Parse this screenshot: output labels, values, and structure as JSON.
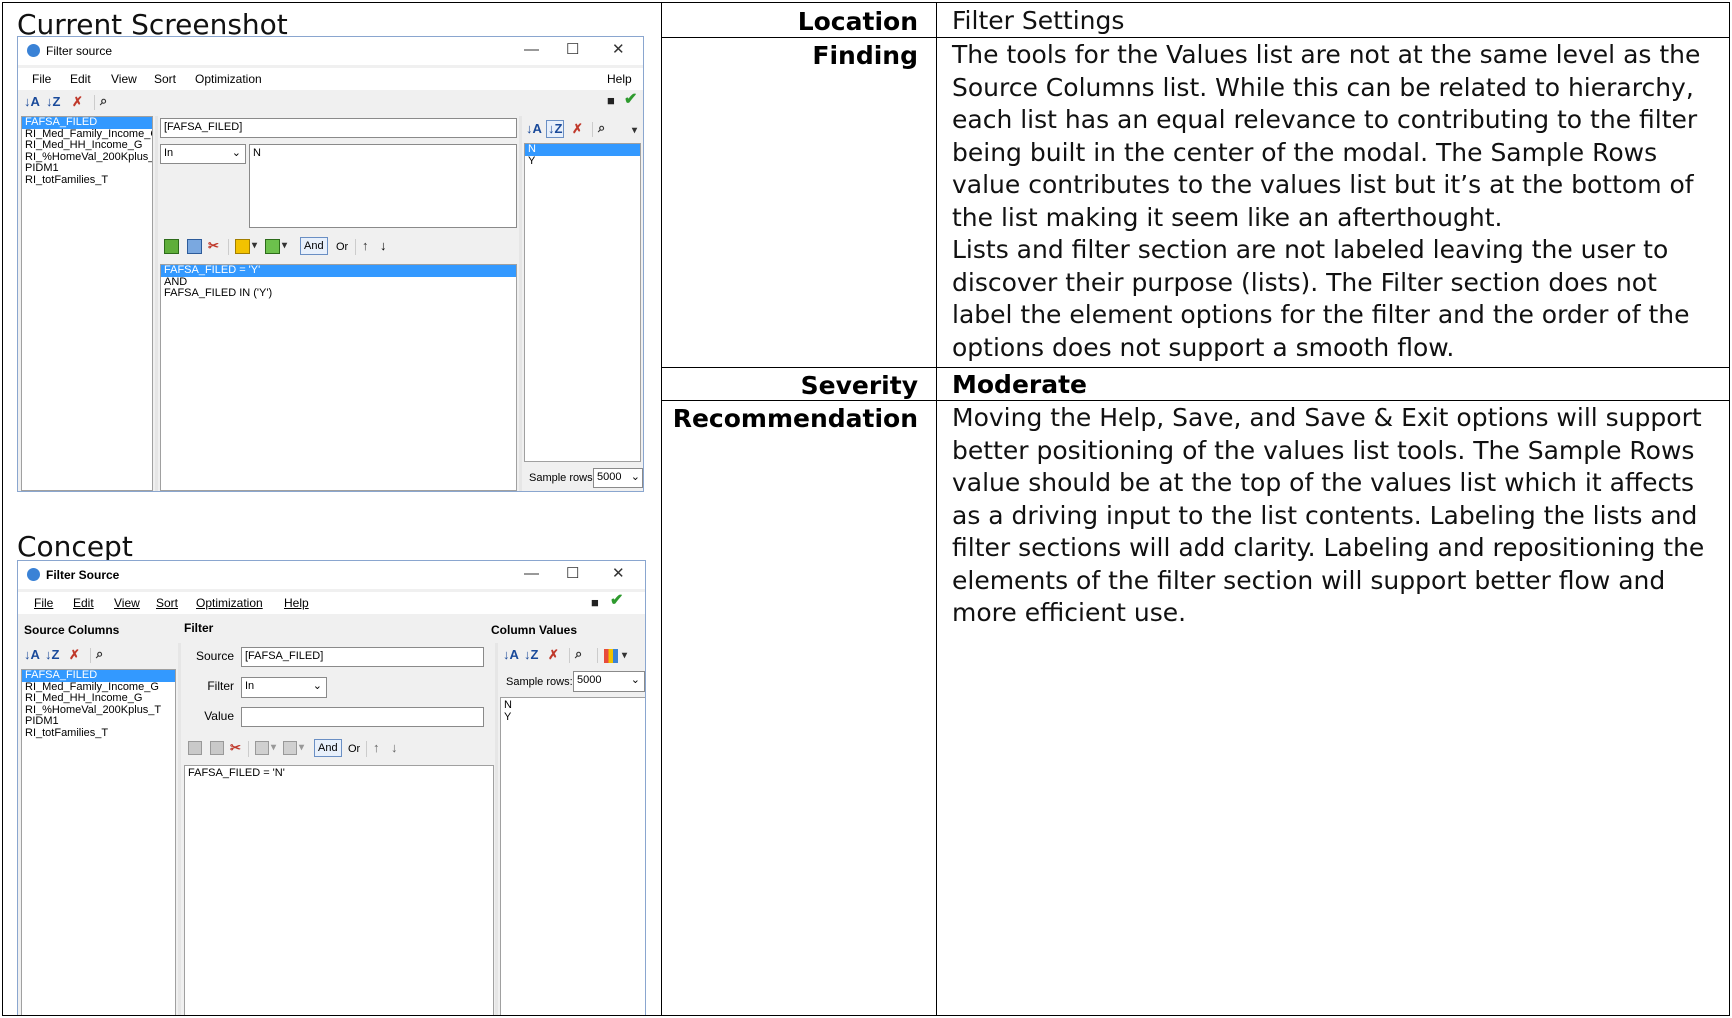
{
  "captions": {
    "current": "Current Screenshot",
    "concept": "Concept"
  },
  "report": {
    "location_label": "Location",
    "location": "Filter Settings",
    "finding_label": "Finding",
    "finding_lines": [
      "The tools for the Values list are not at the same level as the",
      "Source Columns list. While this can be related to hierarchy,",
      "each list has an equal relevance to contributing to the filter",
      "being built in the center of the modal. The Sample Rows",
      "value contributes to the values list but it’s at the bottom of",
      "the list making it seem like an afterthought.",
      "Lists and filter section are not labeled leaving the user to",
      "discover their purpose (lists). The Filter section does not",
      "label the element options for the filter and the order of the",
      "options does not support a smooth flow."
    ],
    "severity_label": "Severity",
    "severity": "Moderate",
    "recommendation_label": "Recommendation",
    "recommendation_lines": [
      "Moving the Help, Save, and Save & Exit options will support",
      "better positioning of the values list tools. The Sample Rows",
      "value should be at the top of the values list which it affects",
      "as a driving input to the list contents. Labeling the lists and",
      "filter sections will add clarity. Labeling and repositioning the",
      "elements of the filter section will support better flow and",
      "more efficient use."
    ]
  },
  "current": {
    "title": "Filter source",
    "menu": [
      "File",
      "Edit",
      "View",
      "Sort",
      "Optimization"
    ],
    "help": "Help",
    "columns": [
      "FAFSA_FILED",
      "RI_Med_Family_Income_G",
      "RI_Med_HH_Income_G",
      "RI_%HomeVal_200Kplus_",
      "PIDM1",
      "RI_totFamilies_T"
    ],
    "source_value": "[FAFSA_FILED]",
    "operator": "In",
    "value_text": "N",
    "and_label": "And",
    "or_label": "Or",
    "expression": [
      "FAFSA_FILED = 'Y'",
      "AND",
      "FAFSA_FILED IN ('Y')"
    ],
    "values": [
      "N",
      "Y"
    ],
    "sample_label": "Sample rows:",
    "sample_value": "5000"
  },
  "concept": {
    "title": "Filter Source",
    "menu": [
      "File",
      "Edit",
      "View",
      "Sort",
      "Optimization",
      "Help"
    ],
    "source_columns_hdr": "Source Columns",
    "filter_hdr": "Filter",
    "column_values_hdr": "Column  Values",
    "columns": [
      "FAFSA_FILED",
      "RI_Med_Family_Income_G",
      "RI_Med_HH_Income_G",
      "RI_%HomeVal_200Kplus_T",
      "PIDM1",
      "RI_totFamilies_T"
    ],
    "source_label": "Source",
    "source_value": "[FAFSA_FILED]",
    "filter_label": "Filter",
    "filter_value": "In",
    "value_label": "Value",
    "value_value": "",
    "and_label": "And",
    "or_label": "Or",
    "expression": [
      "FAFSA_FILED = 'N'"
    ],
    "sample_label": "Sample rows:",
    "sample_value": "5000",
    "values": [
      "N",
      "Y"
    ]
  }
}
